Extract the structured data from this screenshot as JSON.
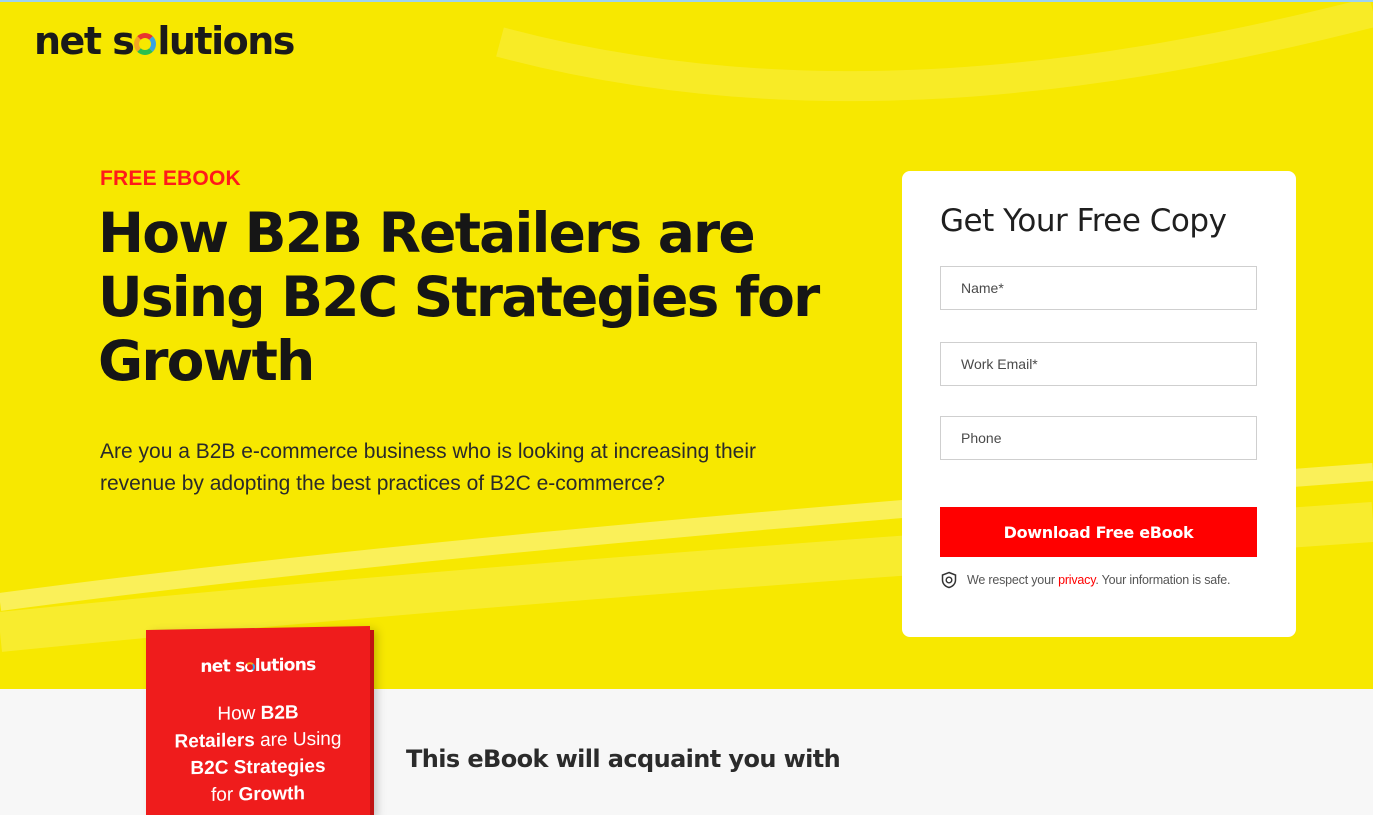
{
  "brand": {
    "logo_before": "net s",
    "logo_after": "lutions"
  },
  "hero": {
    "eyebrow": "FREE EBOOK",
    "headline": "How B2B Retailers are Using B2C Strategies for Growth",
    "intro": "Are you a B2B e-commerce business who is looking at increasing their revenue by adopting the best practices of B2C e-commerce?"
  },
  "form": {
    "title": "Get Your Free Copy",
    "name_placeholder": "Name*",
    "email_placeholder": "Work Email*",
    "phone_placeholder": "Phone",
    "submit_label": "Download Free eBook",
    "privacy_prefix": "We respect your ",
    "privacy_link": "privacy",
    "privacy_suffix": ". Your information is safe."
  },
  "book": {
    "logo_before": "net s",
    "logo_after": "lutions",
    "line1_plain": "How ",
    "line1_bold": "B2B",
    "line2_bold": "Retailers",
    "line2_plain": " are Using",
    "line3_bold": "B2C Strategies",
    "line4_plain": "for ",
    "line4_bold": "Growth"
  },
  "section": {
    "heading": "This eBook will acquaint you with"
  },
  "colors": {
    "hero_bg": "#f7e800",
    "accent_red": "#ff0000",
    "text_dark": "#161616"
  },
  "icons": {
    "privacy": "shield-icon",
    "logo_o": "colorful-o-icon"
  }
}
